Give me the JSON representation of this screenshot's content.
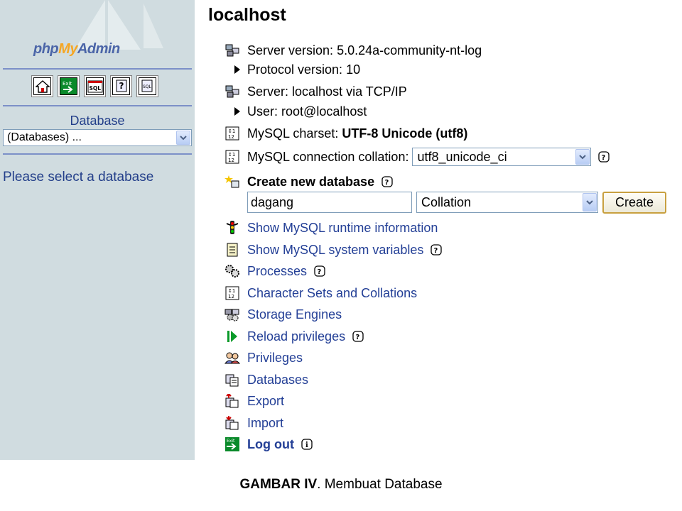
{
  "left_frame": {
    "logo": {
      "php": "php",
      "my": "My",
      "admin": "Admin"
    },
    "nav_icons": [
      "home-icon",
      "exit-icon",
      "sql-icon",
      "help-icon",
      "sql-query-icon"
    ],
    "database_label": "Database",
    "database_select_value": "(Databases) ...",
    "select_message": "Please select a database"
  },
  "main": {
    "title": "localhost",
    "server_version": {
      "label": "Server version: ",
      "value": "5.0.24a-community-nt-log"
    },
    "protocol_version": {
      "label": "Protocol version: ",
      "value": "10"
    },
    "server": {
      "label": "Server: ",
      "value": "localhost via TCP/IP"
    },
    "user": {
      "label": "User: ",
      "value": "root@localhost"
    },
    "charset": {
      "label": "MySQL charset: ",
      "value": "UTF-8 Unicode (utf8)"
    },
    "connection_collation": {
      "label": "MySQL connection collation: ",
      "value": "utf8_unicode_ci"
    },
    "create_db": {
      "heading": "Create new database",
      "name_value": "dagang",
      "collation_value": "Collation",
      "button_label": "Create"
    },
    "links": [
      {
        "label": "Show MySQL runtime information",
        "icon": "traffic-light-icon",
        "help": false
      },
      {
        "label": "Show MySQL system variables",
        "icon": "variables-icon",
        "help": true
      },
      {
        "label": "Processes",
        "icon": "processes-icon",
        "help": true
      },
      {
        "label": "Character Sets and Collations",
        "icon": "charset-icon",
        "help": false
      },
      {
        "label": "Storage Engines",
        "icon": "engines-icon",
        "help": false
      },
      {
        "label": "Reload privileges",
        "icon": "reload-icon",
        "help": true
      },
      {
        "label": "Privileges",
        "icon": "users-icon",
        "help": false
      },
      {
        "label": "Databases",
        "icon": "databases-icon",
        "help": false
      },
      {
        "label": "Export",
        "icon": "export-icon",
        "help": false
      },
      {
        "label": "Import",
        "icon": "import-icon",
        "help": false
      }
    ],
    "logout": {
      "label": "Log out",
      "icon": "exit-icon"
    }
  },
  "caption": {
    "bold": "GAMBAR IV",
    "rest": ". Membuat Database"
  },
  "colors": {
    "left_bg": "#d0dce0",
    "link": "#233f96",
    "left_text": "#233f8a"
  }
}
